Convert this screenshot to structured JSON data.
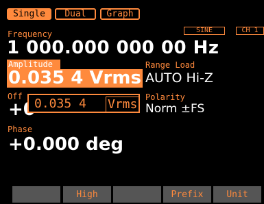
{
  "tabs": [
    {
      "label": "Single"
    },
    {
      "label": "Dual"
    },
    {
      "label": "Graph"
    }
  ],
  "status": {
    "waveform": "SINE",
    "channel": "CH 1"
  },
  "frequency": {
    "label": "Frequency",
    "value": "1 000.000 000 00 Hz"
  },
  "amplitude": {
    "label": "Amplitude",
    "value": "0.035 4 Vrms",
    "hidden_prefix": "0"
  },
  "range_load": {
    "label": "Range Load",
    "value": "AUTO Hi-Z"
  },
  "offset": {
    "label": "Off",
    "value_partial": "+0"
  },
  "polarity": {
    "label": "Polarity",
    "value": "Norm ±FS"
  },
  "phase": {
    "label": "Phase",
    "value": "+0.000 deg"
  },
  "popup": {
    "value": "0.035 4",
    "unit": "Vrms"
  },
  "softkeys": [
    "",
    "High",
    "",
    "Prefix",
    "Unit"
  ],
  "colors": {
    "accent": "#ff8a3d",
    "background": "#000000",
    "value_text": "#ffffff",
    "softkey_bg": "#555555"
  }
}
